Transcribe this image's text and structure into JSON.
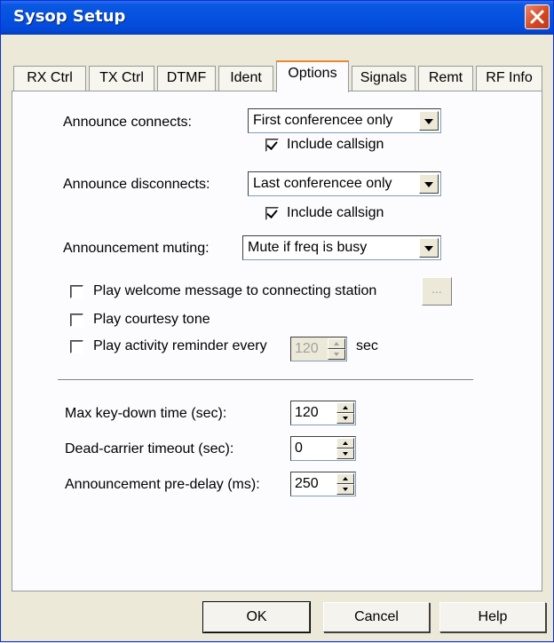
{
  "window": {
    "title": "Sysop Setup"
  },
  "tabs": [
    {
      "label": "RX Ctrl"
    },
    {
      "label": "TX Ctrl"
    },
    {
      "label": "DTMF"
    },
    {
      "label": "Ident"
    },
    {
      "label": "Options"
    },
    {
      "label": "Signals"
    },
    {
      "label": "Remt"
    },
    {
      "label": "RF Info"
    }
  ],
  "active_tab": "Options",
  "options": {
    "announce_connects": {
      "label": "Announce connects:",
      "value": "First conferencee only",
      "include_callsign_label": "Include callsign",
      "include_callsign_checked": true
    },
    "announce_disconnects": {
      "label": "Announce disconnects:",
      "value": "Last conferencee only",
      "include_callsign_label": "Include callsign",
      "include_callsign_checked": true
    },
    "announcement_muting": {
      "label": "Announcement muting:",
      "value": "Mute if freq is busy"
    },
    "play_welcome": {
      "label": "Play welcome message to connecting station",
      "checked": false,
      "browse_label": "..."
    },
    "play_courtesy": {
      "label": "Play courtesy tone",
      "checked": false
    },
    "activity_reminder": {
      "label": "Play activity reminder every",
      "value": "120",
      "unit": "sec",
      "checked": false
    },
    "max_keydown": {
      "label": "Max key-down time (sec):",
      "value": "120"
    },
    "dead_carrier": {
      "label": "Dead-carrier timeout (sec):",
      "value": "0"
    },
    "predelay": {
      "label": "Announcement pre-delay (ms):",
      "value": "250"
    }
  },
  "buttons": {
    "ok": "OK",
    "cancel": "Cancel",
    "help": "Help"
  },
  "icons": {
    "close": "close-icon",
    "check": "checkmark-icon",
    "dropdown": "chevron-down-icon"
  },
  "colors": {
    "titlebar": "#0551e0",
    "close_button": "#d2461f",
    "active_tab_accent": "#e68b2c",
    "dialog_bg": "#ece9d8"
  }
}
